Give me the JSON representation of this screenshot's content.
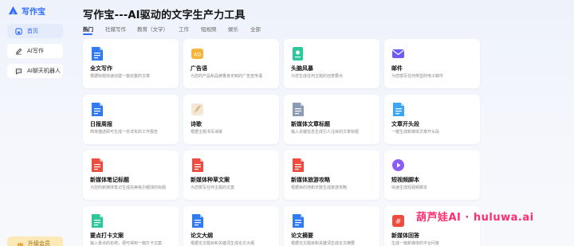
{
  "app": {
    "logo_text": "写作宝",
    "brand_color": "#2f6bff"
  },
  "sidebar": {
    "items": [
      {
        "label": "首页",
        "icon": "home-icon",
        "active": true
      },
      {
        "label": "AI写作",
        "icon": "pen-icon",
        "active": false
      },
      {
        "label": "AI聊天机器人",
        "icon": "chat-icon",
        "active": false
      }
    ],
    "upgrade_label": "升级会员"
  },
  "header": {
    "title": "写作宝---AI驱动的文字生产力工具"
  },
  "tabs": [
    {
      "label": "热门",
      "active": true
    },
    {
      "label": "社媒写作",
      "active": false
    },
    {
      "label": "教育（文学）",
      "active": false
    },
    {
      "label": "工作",
      "active": false
    },
    {
      "label": "短视频",
      "active": false
    },
    {
      "label": "娱乐",
      "active": false
    },
    {
      "label": "全部",
      "active": false
    }
  ],
  "cards": [
    {
      "title": "全文写作",
      "desc": "根据标题快速创建一篇完整的文章",
      "icon": "document-icon",
      "color": "#2f7bf6"
    },
    {
      "title": "广告语",
      "desc": "为您的产品和品牌量身定制的广告宣传语",
      "icon": "megaphone-icon",
      "color": "#f5b53a"
    },
    {
      "title": "头脑风暴",
      "desc": "为您生成任何主题的创意要点",
      "icon": "brainstorm-icon",
      "color": "#2cc79a"
    },
    {
      "title": "邮件",
      "desc": "为您撰写任何类型的电子邮件",
      "icon": "mail-icon",
      "color": "#6b5cf5"
    },
    {
      "title": "日报周报",
      "desc": "简单描述即可生成一份详实的工作报告",
      "icon": "report-icon",
      "color": "#2f7bf6"
    },
    {
      "title": "诗歌",
      "desc": "根据主题书写诗歌",
      "icon": "quill-icon",
      "color": "#d9b98c"
    },
    {
      "title": "新媒体文章标题",
      "desc": "输入关键信息生成引人注目的文章标题",
      "icon": "headline-icon",
      "color": "#8a9bb3"
    },
    {
      "title": "文章开头段",
      "desc": "一键生成新媒体文章开头段",
      "icon": "paragraph-icon",
      "color": "#3aa6f5"
    },
    {
      "title": "新媒体笔记标题",
      "desc": "为您的新媒体笔记生成完美吸引眼球的标题",
      "icon": "note-icon",
      "color": "#ef4b3f"
    },
    {
      "title": "新媒体种草文案",
      "desc": "为您撰写任何主题的文案",
      "icon": "note-icon",
      "color": "#ef4b3f"
    },
    {
      "title": "新媒体旅游攻略",
      "desc": "根据目的地和天数生成旅游攻略",
      "icon": "note-icon",
      "color": "#ef4b3f"
    },
    {
      "title": "短视频脚本",
      "desc": "快速生成短视频脚本",
      "icon": "video-icon",
      "color": "#8b5cf6"
    },
    {
      "title": "要点打卡文案",
      "desc": "输入景点的名称，便可得到一篇打卡文案",
      "icon": "checkin-icon",
      "color": "#2cc79a"
    },
    {
      "title": "论文大纲",
      "desc": "根据论文题目和关键词生成论文大纲",
      "icon": "outline-icon",
      "color": "#2f7bf6"
    },
    {
      "title": "论文摘要",
      "desc": "根据论文题目和关键词生成论文摘要",
      "icon": "abstract-icon",
      "color": "#2f7bf6"
    },
    {
      "title": "新媒体回答",
      "desc": "生成一篇新媒体的平台问答",
      "icon": "hashtag-icon",
      "color": "#ef4b3f"
    }
  ],
  "watermark": "葫芦娃AI · huluwa.ai"
}
